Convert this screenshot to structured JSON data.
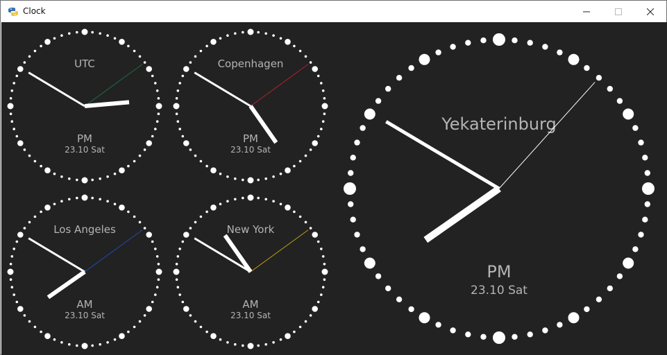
{
  "window": {
    "title": "Clock",
    "icons": {
      "app": "snake-icon",
      "minimize": "minimize-icon",
      "maximize": "maximize-icon",
      "close": "close-icon"
    }
  },
  "colors": {
    "background": "#222222",
    "text": "#b4b4b4",
    "hands": "#ffffff",
    "ticks": "#ffffff"
  },
  "clocks": [
    {
      "id": "utc",
      "name": "UTC",
      "ampm": "PM",
      "date": "23.10 Sat",
      "time": {
        "h": 14,
        "m": 50,
        "s": 9
      },
      "second_hand_color": "#1f6e43"
    },
    {
      "id": "copenhagen",
      "name": "Copenhagen",
      "ampm": "PM",
      "date": "23.10 Sat",
      "time": {
        "h": 16,
        "m": 50,
        "s": 9
      },
      "second_hand_color": "#b3212f"
    },
    {
      "id": "los-angeles",
      "name": "Los Angeles",
      "ampm": "AM",
      "date": "23.10 Sat",
      "time": {
        "h": 7,
        "m": 50,
        "s": 9
      },
      "second_hand_color": "#1f4fb3"
    },
    {
      "id": "new-york",
      "name": "New York",
      "ampm": "AM",
      "date": "23.10 Sat",
      "time": {
        "h": 10,
        "m": 50,
        "s": 9
      },
      "second_hand_color": "#c89a13"
    },
    {
      "id": "yekaterinburg",
      "name": "Yekaterinburg",
      "ampm": "PM",
      "date": "23.10 Sat",
      "time": {
        "h": 19,
        "m": 50,
        "s": 7
      },
      "second_hand_color": "#ffffff"
    }
  ]
}
